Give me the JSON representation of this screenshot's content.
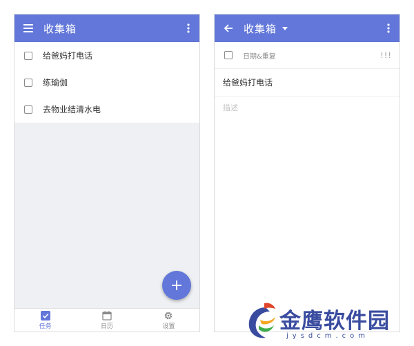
{
  "colors": {
    "primary": "#6277d9",
    "list_background": "#eef0f3",
    "inactive": "#8a8a8a",
    "watermark": "#3a4ca0"
  },
  "left_screen": {
    "header": {
      "title": "收集箱",
      "menu_icon": "hamburger-menu-icon",
      "more_icon": "more-vert-icon"
    },
    "tasks": [
      {
        "label": "给爸妈打电话",
        "checked": false
      },
      {
        "label": "练瑜伽",
        "checked": false
      },
      {
        "label": "去物业结清水电",
        "checked": false
      }
    ],
    "fab": {
      "icon": "plus-icon"
    },
    "bottom_nav": [
      {
        "label": "任务",
        "icon": "checkbox-icon",
        "active": true
      },
      {
        "label": "日历",
        "icon": "calendar-icon",
        "active": false
      },
      {
        "label": "设置",
        "icon": "gear-icon",
        "active": false
      }
    ]
  },
  "right_screen": {
    "header": {
      "title": "收集箱",
      "back_icon": "arrow-left-icon",
      "dropdown_icon": "caret-down-icon",
      "more_icon": "more-vert-icon"
    },
    "date_repeat_label": "日期&重复",
    "priority_label": "!!!",
    "task_title": "给爸妈打电话",
    "description_placeholder": "描述"
  },
  "watermark": {
    "name": "金鹰软件园",
    "url": "jysdcm.com"
  }
}
